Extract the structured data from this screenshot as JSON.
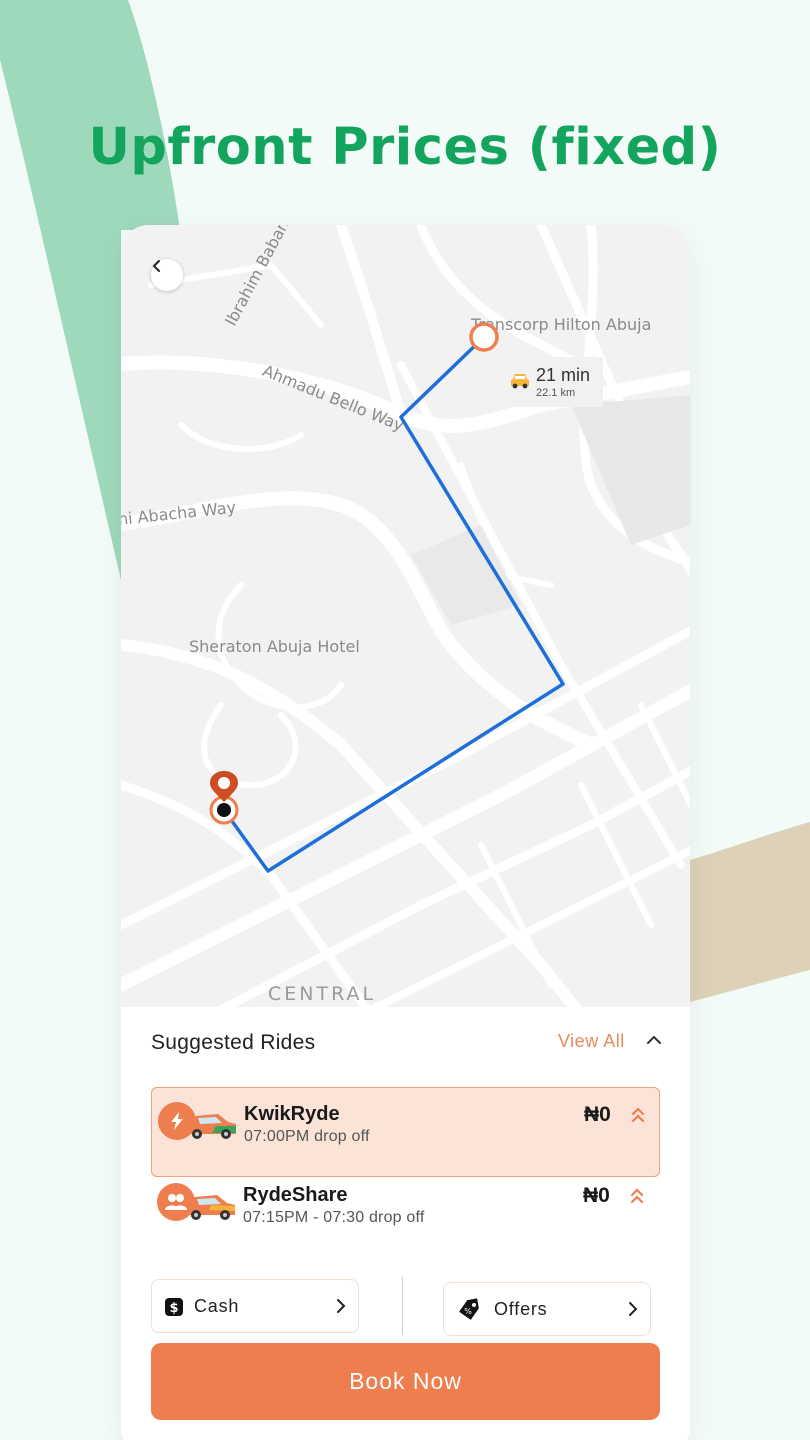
{
  "headline": "Upfront Prices (fixed)",
  "map": {
    "labels": {
      "hilton": "Transcorp Hilton Abuja",
      "ibrahim": "Ibrahim Babangida",
      "ahmadu": "Ahmadu Bello Way",
      "abacha": "ni Abacha Way",
      "sheraton": "Sheraton Abuja Hotel",
      "central": "CENTRAL"
    },
    "eta": {
      "time": "21 min",
      "distance": "22.1 km"
    }
  },
  "panel": {
    "title": "Suggested Rides",
    "view_all": "View All",
    "rides": [
      {
        "name": "KwikRyde",
        "time": "07:00PM drop off",
        "price": "₦0",
        "selected": true
      },
      {
        "name": "RydeShare",
        "time": "07:15PM - 07:30 drop off",
        "price": "₦0",
        "selected": false
      }
    ],
    "payment": {
      "cash_label": "Cash",
      "offers_label": "Offers"
    },
    "book_label": "Book Now"
  },
  "colors": {
    "brand_green": "#13a55e",
    "accent_orange": "#ee7e4d",
    "route_blue": "#1e6fd9"
  }
}
